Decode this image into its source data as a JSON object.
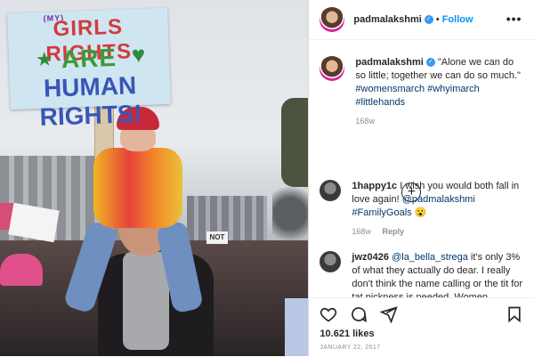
{
  "photo": {
    "sign": {
      "small_word": "(MY)",
      "line1_a": "GIRLS RIGHTS",
      "line2": "ARE",
      "line3": "HUMAN RIGHTS!"
    },
    "crowd_sign_text": "NOT"
  },
  "header": {
    "username": "padmalakshmi",
    "separator": "•",
    "follow_label": "Follow",
    "more_label": "•••"
  },
  "caption": {
    "username": "padmalakshmi",
    "text": "\"Alone we can do so little; together we can do so much.\"",
    "hashtags": "#womensmarch #whyimarch #littlehands",
    "age": "168w"
  },
  "load_more_icon": "plus-circle-icon",
  "comments": [
    {
      "username": "1happy1c",
      "text": "I wish you would both fall in love again!",
      "mention": "@padmalakshmi",
      "tag": "#FamilyGoals",
      "emoji": "😮",
      "age": "168w",
      "reply_label": "Reply"
    },
    {
      "username": "jwz0426",
      "mention": "@la_bella_strega",
      "text": "it's only 3% of what they actually do dear. I really don't think the name calling or the tit for tat pickness is needed. Women"
    }
  ],
  "footer": {
    "likes": "10.621 likes",
    "date": "JANUARY 22, 2017"
  },
  "colors": {
    "accent": "#0095f6",
    "hashtag": "#00376b",
    "muted": "#8e8e8e",
    "verified": "#3897f0"
  }
}
